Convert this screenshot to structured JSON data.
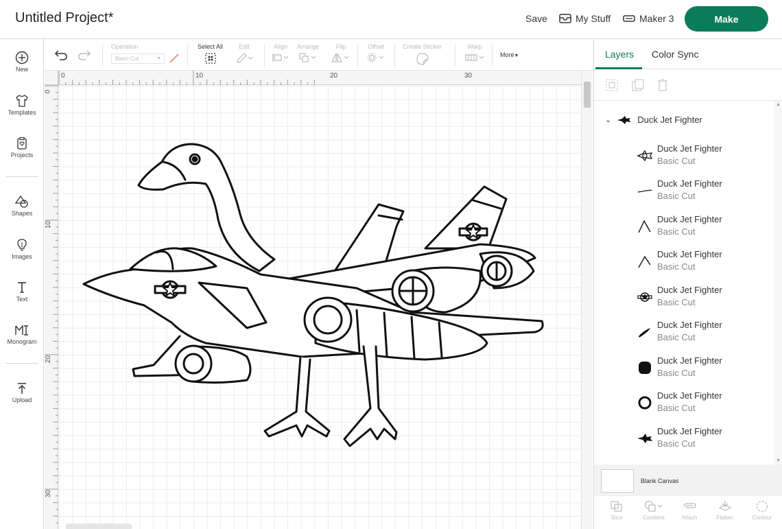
{
  "header": {
    "title": "Untitled Project*",
    "save_label": "Save",
    "mystuff_label": "My Stuff",
    "machine_label": "Maker 3",
    "make_label": "Make"
  },
  "sidebar": {
    "items": [
      {
        "label": "New",
        "icon": "plus-circle-icon"
      },
      {
        "label": "Templates",
        "icon": "shirt-icon"
      },
      {
        "label": "Projects",
        "icon": "projects-icon"
      },
      {
        "label": "Shapes",
        "icon": "shapes-icon"
      },
      {
        "label": "Images",
        "icon": "lightbulb-icon"
      },
      {
        "label": "Text",
        "icon": "text-icon"
      },
      {
        "label": "Monogram",
        "icon": "monogram-icon"
      },
      {
        "label": "Upload",
        "icon": "upload-icon"
      }
    ]
  },
  "toolbar": {
    "operation_label": "Operation",
    "operation_value": "Basic Cut",
    "select_all_label": "Select All",
    "edit_label": "Edit",
    "align_label": "Align",
    "arrange_label": "Arrange",
    "flip_label": "Flip",
    "offset_label": "Offset",
    "create_sticker_label": "Create Sticker",
    "warp_label": "Warp",
    "more_label": "More"
  },
  "rulers": {
    "top": [
      "0",
      "10",
      "20",
      "30"
    ],
    "left": [
      "0",
      "10",
      "20",
      "30"
    ]
  },
  "panel": {
    "tabs": [
      "Layers",
      "Color Sync"
    ],
    "group_name": "Duck Jet Fighter",
    "layers": [
      {
        "name": "Duck Jet Fighter",
        "op": "Basic Cut",
        "icon": "jet-small-icon"
      },
      {
        "name": "Duck Jet Fighter",
        "op": "Basic Cut",
        "icon": "line-icon"
      },
      {
        "name": "Duck Jet Fighter",
        "op": "Basic Cut",
        "icon": "caret-icon"
      },
      {
        "name": "Duck Jet Fighter",
        "op": "Basic Cut",
        "icon": "caret-icon"
      },
      {
        "name": "Duck Jet Fighter",
        "op": "Basic Cut",
        "icon": "star-badge-icon"
      },
      {
        "name": "Duck Jet Fighter",
        "op": "Basic Cut",
        "icon": "slash-icon"
      },
      {
        "name": "Duck Jet Fighter",
        "op": "Basic Cut",
        "icon": "blob-icon"
      },
      {
        "name": "Duck Jet Fighter",
        "op": "Basic Cut",
        "icon": "ring-icon"
      },
      {
        "name": "Duck Jet Fighter",
        "op": "Basic Cut",
        "icon": "jet-silhouette-icon"
      }
    ],
    "blank_canvas_label": "Blank Canvas",
    "bottom_tools": [
      "Slice",
      "Combine",
      "Attach",
      "Flatten",
      "Contour"
    ]
  },
  "colors": {
    "accent": "#0a7c58",
    "border": "#d6d6d6"
  }
}
